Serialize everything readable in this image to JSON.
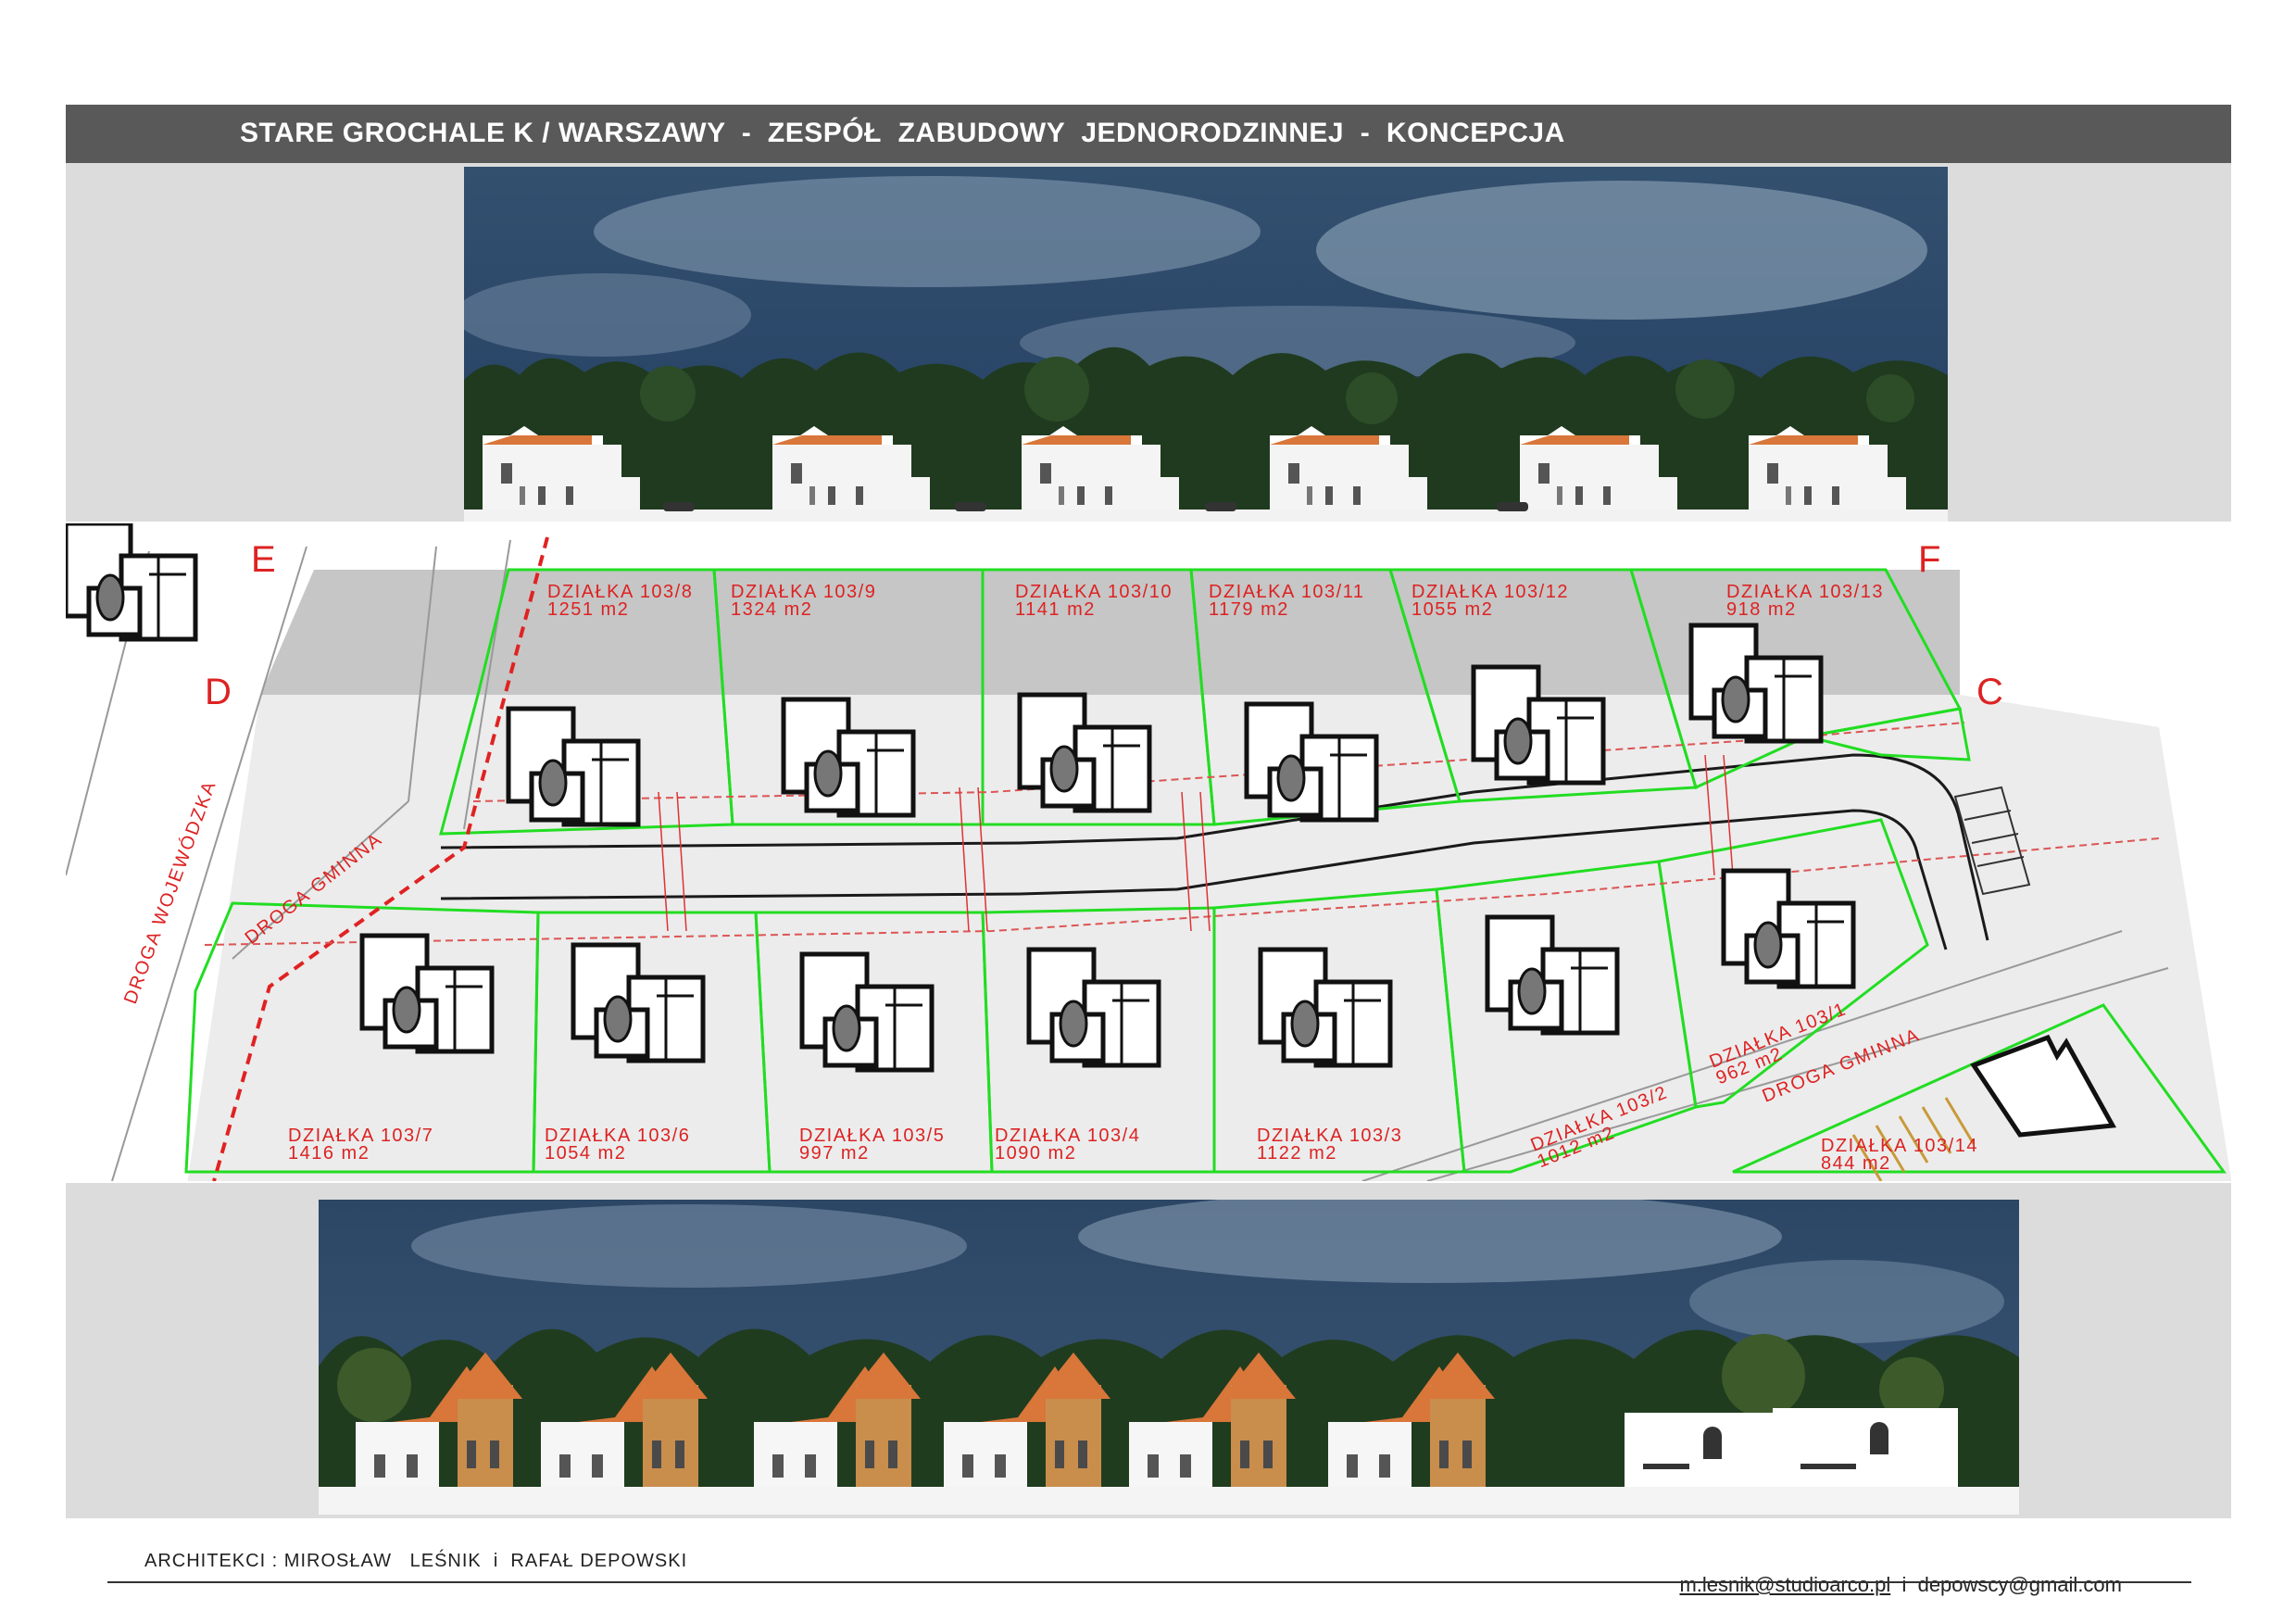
{
  "header": {
    "title": "STARE GROCHALE K / WARSZAWY  -  ZESPÓŁ  ZABUDOWY  JEDNORODZINNEJ  -  KONCEPCJA"
  },
  "plan": {
    "section_markers": [
      "E",
      "F",
      "D",
      "C"
    ],
    "roads": {
      "wojewodzka": "DROGA WOJEWÓDZKA",
      "gminna_left": "DROGA GMINNA",
      "gminna_right": "DROGA GMINNA"
    },
    "plots_top": [
      {
        "id": "DZIAŁKA 103/8",
        "area": "1251 m2"
      },
      {
        "id": "DZIAŁKA 103/9",
        "area": "1324 m2"
      },
      {
        "id": "DZIAŁKA 103/10",
        "area": "1141 m2"
      },
      {
        "id": "DZIAŁKA 103/11",
        "area": "1179 m2"
      },
      {
        "id": "DZIAŁKA 103/12",
        "area": "1055 m2"
      },
      {
        "id": "DZIAŁKA 103/13",
        "area": "918 m2"
      }
    ],
    "plots_bottom": [
      {
        "id": "DZIAŁKA 103/7",
        "area": "1416 m2"
      },
      {
        "id": "DZIAŁKA 103/6",
        "area": "1054 m2"
      },
      {
        "id": "DZIAŁKA 103/5",
        "area": "997 m2"
      },
      {
        "id": "DZIAŁKA 103/4",
        "area": "1090 m2"
      },
      {
        "id": "DZIAŁKA 103/3",
        "area": "1122 m2"
      },
      {
        "id": "DZIAŁKA 103/2",
        "area": "1012 m2"
      },
      {
        "id": "DZIAŁKA 103/1",
        "area": "962 m2"
      },
      {
        "id": "DZIAŁKA 103/14",
        "area": "844 m2"
      }
    ]
  },
  "footer": {
    "architects": "ARCHITEKCI : MIROSŁAW   LEŚNIK  i  RAFAŁ DEPOWSKI",
    "email1": "m.lesnik@studioarco.pl",
    "separator": "  i  ",
    "email2": "depowscy@gmail.com"
  },
  "colors": {
    "title_bar": "#595959",
    "plot_border": "#22dd22",
    "label_red": "#dd2222",
    "sky": "#2e4a6e",
    "roof": "#d9763a"
  }
}
